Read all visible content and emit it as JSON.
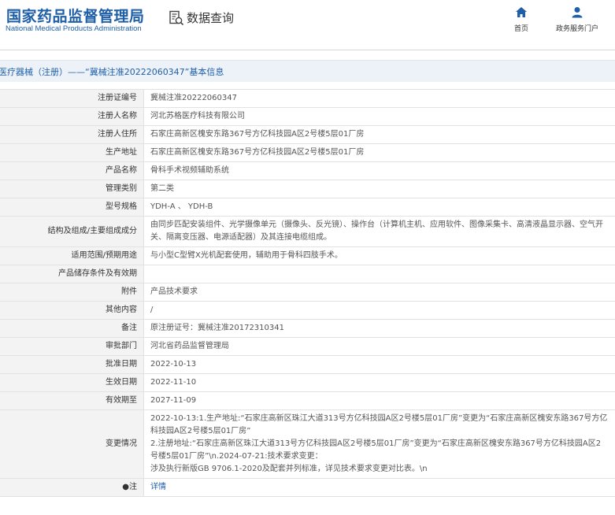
{
  "header": {
    "logo_cn": "国家药品监督管理局",
    "logo_en": "National Medical Products Administration",
    "query_title": "数据查询",
    "query_icon": "search-document-icon",
    "nav": [
      {
        "label": "首页",
        "icon": "home-icon"
      },
      {
        "label": "政务服务门户",
        "icon": "user-icon"
      }
    ]
  },
  "title_bar": {
    "text": "医疗器械（注册）——“冀械注准20222060347”基本信息"
  },
  "rows": [
    {
      "label": "注册证编号",
      "value": "冀械注准20222060347"
    },
    {
      "label": "注册人名称",
      "value": "河北苏格医疗科技有限公司"
    },
    {
      "label": "注册人住所",
      "value": "石家庄高新区槐安东路367号方亿科技园A区2号楼5层01厂房"
    },
    {
      "label": "生产地址",
      "value": "石家庄高新区槐安东路367号方亿科技园A区2号楼5层01厂房"
    },
    {
      "label": "产品名称",
      "value": "骨科手术视频辅助系统"
    },
    {
      "label": "管理类别",
      "value": "第二类"
    },
    {
      "label": "型号规格",
      "value": "YDH-A 、 YDH-B"
    },
    {
      "label": "结构及组成/主要组成成分",
      "value": "由同步匹配安装组件、光学摄像单元（摄像头、反光镜）、操作台（计算机主机、应用软件、图像采集卡、高清液晶显示器、空气开关、隔离变压器、电源适配器）及其连接电缆组成。"
    },
    {
      "label": "适用范围/预期用途",
      "value": "与小型C型臂X光机配套使用，辅助用于骨科四肢手术。"
    },
    {
      "label": "产品储存条件及有效期",
      "value": ""
    },
    {
      "label": "附件",
      "value": "产品技术要求"
    },
    {
      "label": "其他内容",
      "value": "/"
    },
    {
      "label": "备注",
      "value": "原注册证号：冀械注准20172310341"
    },
    {
      "label": "审批部门",
      "value": "河北省药品监督管理局"
    },
    {
      "label": "批准日期",
      "value": "2022-10-13"
    },
    {
      "label": "生效日期",
      "value": "2022-11-10"
    },
    {
      "label": "有效期至",
      "value": "2027-11-09"
    },
    {
      "label": "变更情况",
      "value": "2022-10-13:1.生产地址:“石家庄高新区珠江大道313号方亿科技园A区2号楼5层01厂房”变更为“石家庄高新区槐安东路367号方亿科技园A区2号楼5层01厂房”\n2.注册地址:“石家庄高新区珠江大道313号方亿科技园A区2号楼5层01厂房”变更为“石家庄高新区槐安东路367号方亿科技园A区2号楼5层01厂房”\\n.2024-07-21:技术要求变更：\n涉及执行新版GB 9706.1-2020及配套并列标准，详见技术要求变更对比表。\\n"
    },
    {
      "label": "●注",
      "value": "详情"
    }
  ],
  "colors": {
    "brand": "#1f5fa8",
    "label_bg": "#f3f3f3",
    "border": "#e2e2e2",
    "title_bar_bg": "#edf2f8"
  }
}
